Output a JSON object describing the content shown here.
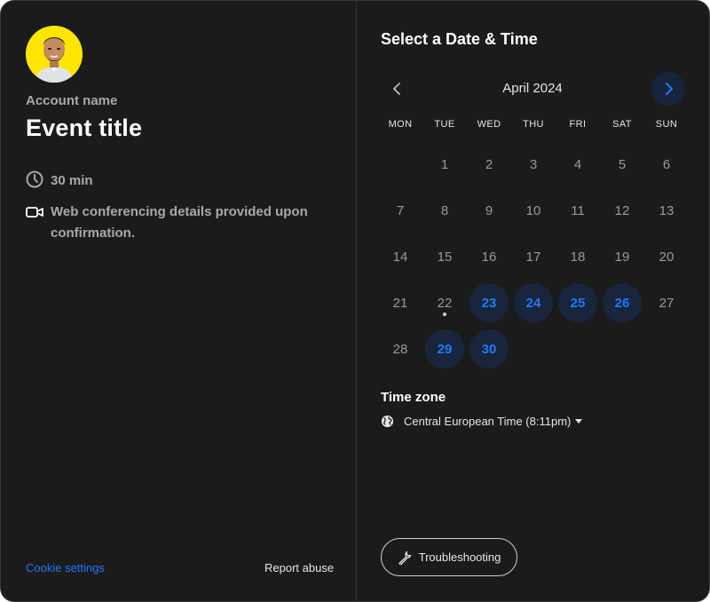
{
  "profile": {
    "account_name": "Account name",
    "event_title": "Event title",
    "duration": "30 min",
    "conferencing": "Web conferencing details provided upon confirmation.",
    "avatar_bg": "#ffe600"
  },
  "footer": {
    "cookie_settings": "Cookie settings",
    "report_abuse": "Report abuse"
  },
  "scheduler": {
    "title": "Select a Date & Time",
    "month": "April 2024",
    "weekdays": [
      "MON",
      "TUE",
      "WED",
      "THU",
      "FRI",
      "SAT",
      "SUN"
    ],
    "days": [
      {
        "day": "1",
        "available": false
      },
      {
        "day": "2",
        "available": false
      },
      {
        "day": "3",
        "available": false
      },
      {
        "day": "4",
        "available": false
      },
      {
        "day": "5",
        "available": false
      },
      {
        "day": "6",
        "available": false
      },
      {
        "day": "7",
        "available": false
      },
      {
        "day": "8",
        "available": false
      },
      {
        "day": "9",
        "available": false
      },
      {
        "day": "10",
        "available": false
      },
      {
        "day": "11",
        "available": false
      },
      {
        "day": "12",
        "available": false
      },
      {
        "day": "13",
        "available": false
      },
      {
        "day": "14",
        "available": false
      },
      {
        "day": "15",
        "available": false
      },
      {
        "day": "16",
        "available": false
      },
      {
        "day": "17",
        "available": false
      },
      {
        "day": "18",
        "available": false
      },
      {
        "day": "19",
        "available": false
      },
      {
        "day": "20",
        "available": false
      },
      {
        "day": "21",
        "available": false
      },
      {
        "day": "22",
        "available": false,
        "today": true
      },
      {
        "day": "23",
        "available": true
      },
      {
        "day": "24",
        "available": true
      },
      {
        "day": "25",
        "available": true
      },
      {
        "day": "26",
        "available": true
      },
      {
        "day": "27",
        "available": false
      },
      {
        "day": "28",
        "available": false
      },
      {
        "day": "29",
        "available": true
      },
      {
        "day": "30",
        "available": true
      }
    ],
    "first_weekday_index": 1,
    "timezone_title": "Time zone",
    "timezone_value": "Central European Time (8:11pm)",
    "troubleshooting": "Troubleshooting"
  },
  "colors": {
    "accent": "#1f7aff",
    "available_bg": "#18253d",
    "panel_bg": "#1b1b1b"
  },
  "icons": {
    "duration": "clock-icon",
    "conferencing": "video-camera-icon",
    "timezone": "globe-icon",
    "troubleshooting": "wrench-icon",
    "prev": "chevron-left-icon",
    "next": "chevron-right-icon"
  }
}
